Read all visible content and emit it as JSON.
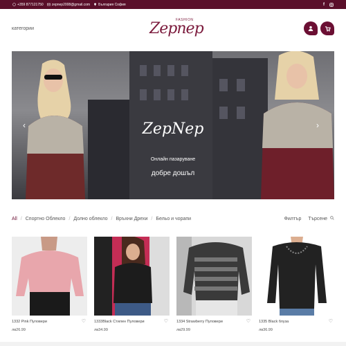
{
  "topbar": {
    "phone": "+359 877121750",
    "email": "zepnep2008@gmail.com",
    "location": "България София",
    "social": [
      "facebook-icon",
      "instagram-icon"
    ]
  },
  "header": {
    "menu_label": "категории",
    "logo_script": "Zepnep",
    "logo_tag": "FASHION"
  },
  "hero": {
    "title": "ZepNep",
    "subtitle": "Онлайн пазаруване",
    "welcome": "добре дошъл"
  },
  "filters": {
    "categories": [
      "All",
      "Спортно Облекло",
      "Долно облекло",
      "Връхни Дрехи",
      "Бельо и чорапи"
    ],
    "filter_label": "Филтър",
    "search_label": "Търсене"
  },
  "products": [
    {
      "name": "1332 Pink Пуловери",
      "price": "лв26.99"
    },
    {
      "name": "1333Black Стилен Пуловери",
      "price": "лв34.99"
    },
    {
      "name": "1334 Strawberry Пуловери",
      "price": "лв29.99"
    },
    {
      "name": "1335 Black блуза",
      "price": "лв36.99"
    }
  ],
  "colors": {
    "brand": "#6b0f33",
    "topbar": "#5a0f2a"
  }
}
